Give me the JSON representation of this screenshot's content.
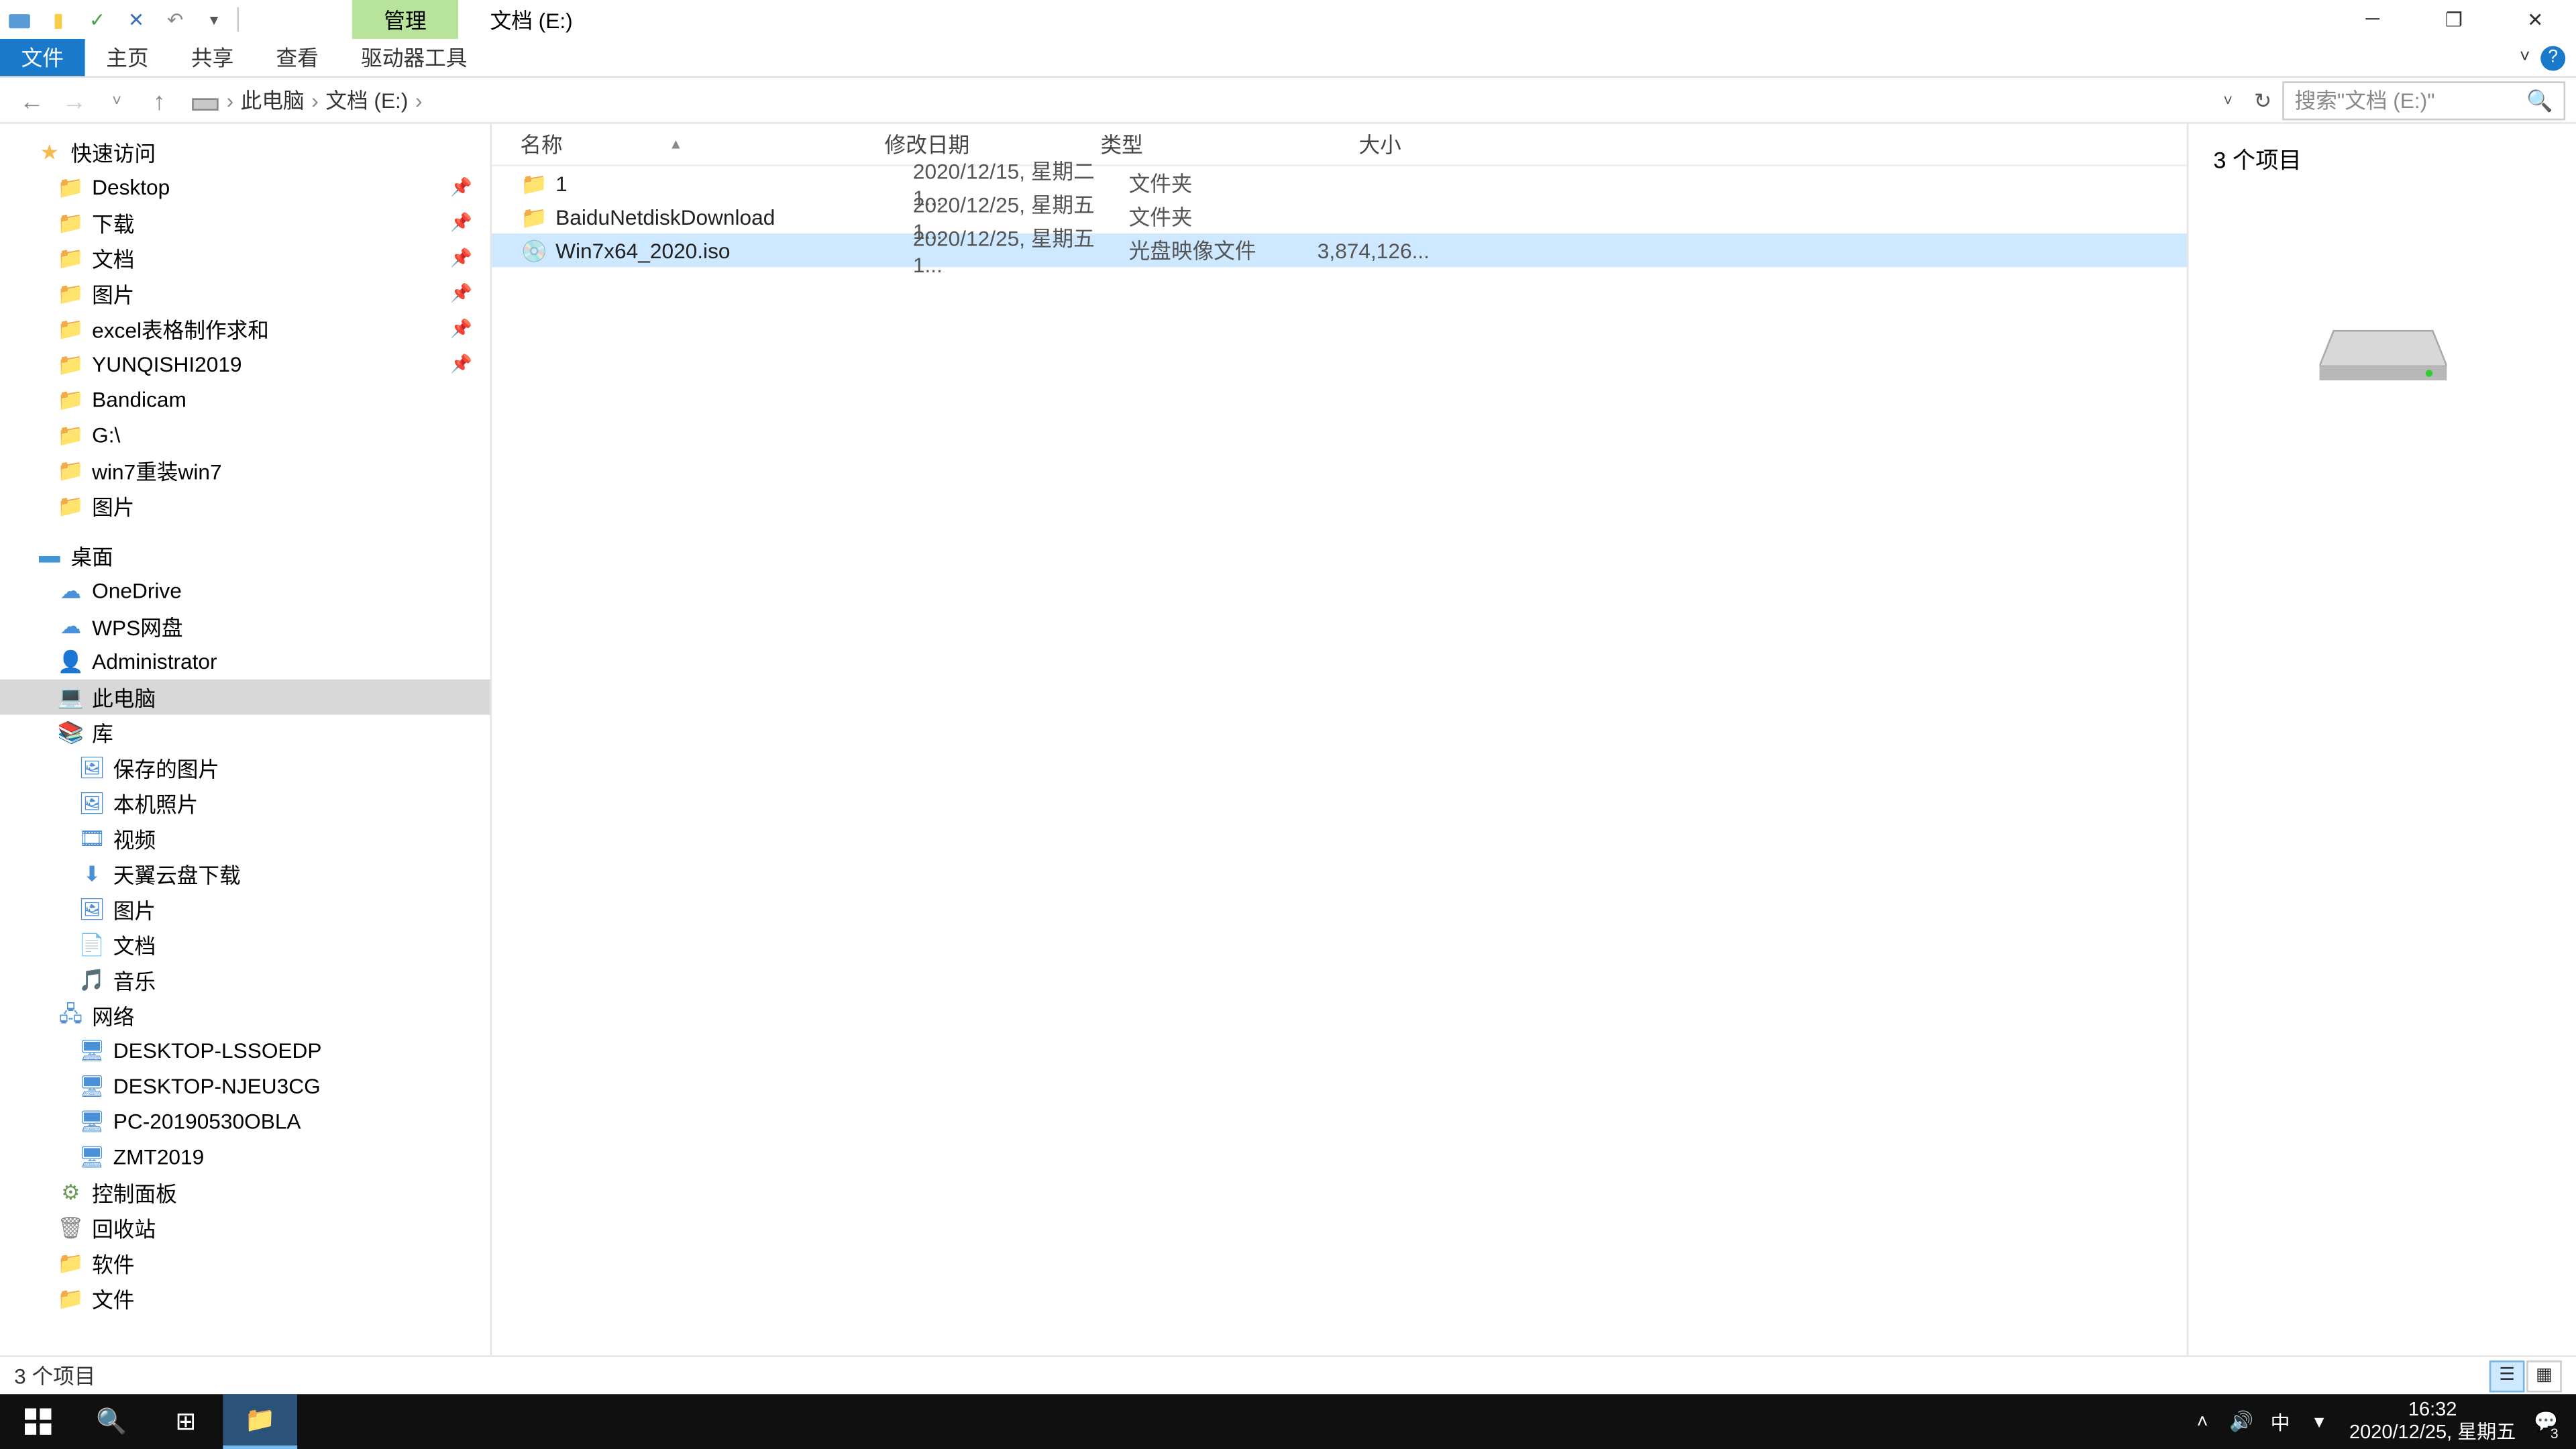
{
  "titlebar": {
    "contextual_tab": "管理",
    "window_title": "文档 (E:)"
  },
  "ribbon": {
    "file": "文件",
    "home": "主页",
    "share": "共享",
    "view": "查看",
    "drive_tools": "驱动器工具"
  },
  "breadcrumb": {
    "this_pc": "此电脑",
    "location": "文档 (E:)"
  },
  "search": {
    "placeholder": "搜索\"文档 (E:)\""
  },
  "sidebar": {
    "quick_access": "快速访问",
    "pinned": [
      {
        "label": "Desktop"
      },
      {
        "label": "下载"
      },
      {
        "label": "文档"
      },
      {
        "label": "图片"
      },
      {
        "label": "excel表格制作求和"
      },
      {
        "label": "YUNQISHI2019"
      }
    ],
    "recent": [
      {
        "label": "Bandicam"
      },
      {
        "label": "G:\\"
      },
      {
        "label": "win7重装win7"
      },
      {
        "label": "图片"
      }
    ],
    "desktop": "桌面",
    "desktop_items": [
      {
        "label": "OneDrive",
        "icon": "cloud"
      },
      {
        "label": "WPS网盘",
        "icon": "cloud"
      },
      {
        "label": "Administrator",
        "icon": "user"
      },
      {
        "label": "此电脑",
        "icon": "pc",
        "selected": true
      },
      {
        "label": "库",
        "icon": "lib"
      },
      {
        "label": "保存的图片",
        "icon": "pic",
        "indent": 2
      },
      {
        "label": "本机照片",
        "icon": "pic",
        "indent": 2
      },
      {
        "label": "视频",
        "icon": "vid",
        "indent": 2
      },
      {
        "label": "天翼云盘下载",
        "icon": "dl",
        "indent": 2
      },
      {
        "label": "图片",
        "icon": "pic",
        "indent": 2
      },
      {
        "label": "文档",
        "icon": "doc",
        "indent": 2
      },
      {
        "label": "音乐",
        "icon": "mus",
        "indent": 2
      },
      {
        "label": "网络",
        "icon": "net"
      },
      {
        "label": "DESKTOP-LSSOEDP",
        "icon": "comp",
        "indent": 2
      },
      {
        "label": "DESKTOP-NJEU3CG",
        "icon": "comp",
        "indent": 2
      },
      {
        "label": "PC-20190530OBLA",
        "icon": "comp",
        "indent": 2
      },
      {
        "label": "ZMT2019",
        "icon": "comp",
        "indent": 2
      },
      {
        "label": "控制面板",
        "icon": "cp"
      },
      {
        "label": "回收站",
        "icon": "bin"
      },
      {
        "label": "软件",
        "icon": "fld"
      },
      {
        "label": "文件",
        "icon": "fld"
      }
    ]
  },
  "columns": {
    "name": "名称",
    "date": "修改日期",
    "type": "类型",
    "size": "大小"
  },
  "files": [
    {
      "name": "1",
      "date": "2020/12/15, 星期二 1...",
      "type": "文件夹",
      "size": "",
      "icon": "folder",
      "selected": false
    },
    {
      "name": "BaiduNetdiskDownload",
      "date": "2020/12/25, 星期五 1...",
      "type": "文件夹",
      "size": "",
      "icon": "folder",
      "selected": false
    },
    {
      "name": "Win7x64_2020.iso",
      "date": "2020/12/25, 星期五 1...",
      "type": "光盘映像文件",
      "size": "3,874,126...",
      "icon": "iso",
      "selected": true
    }
  ],
  "preview": {
    "item_count": "3 个项目"
  },
  "statusbar": {
    "item_count": "3 个项目"
  },
  "taskbar": {
    "time": "16:32",
    "date": "2020/12/25, 星期五",
    "ime": "中",
    "notification_count": "3"
  }
}
